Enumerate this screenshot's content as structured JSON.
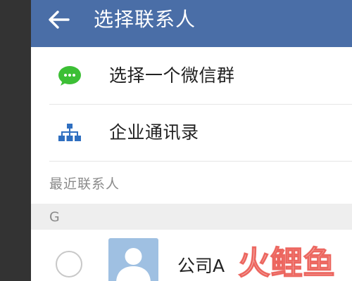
{
  "header": {
    "title": "选择联系人",
    "back_icon": "arrow-left-icon"
  },
  "options": [
    {
      "label": "选择一个微信群",
      "icon": "wechat-bubble-icon",
      "icon_color": "#3cbf35"
    },
    {
      "label": "企业通讯录",
      "icon": "org-chart-icon",
      "icon_color": "#2f6fc0"
    }
  ],
  "recent": {
    "label": "最近联系人"
  },
  "section": {
    "letter": "G"
  },
  "contacts": [
    {
      "name": "公司A",
      "selected": false,
      "avatar": "person-avatar-icon"
    }
  ],
  "watermark": {
    "text": "火鲤鱼",
    "colors": [
      "#e8453c",
      "#f2a19b"
    ]
  },
  "colors": {
    "header": "#4a6ea7",
    "header_text": "#ffffff",
    "avatar_bg": "#9fc0e2"
  }
}
